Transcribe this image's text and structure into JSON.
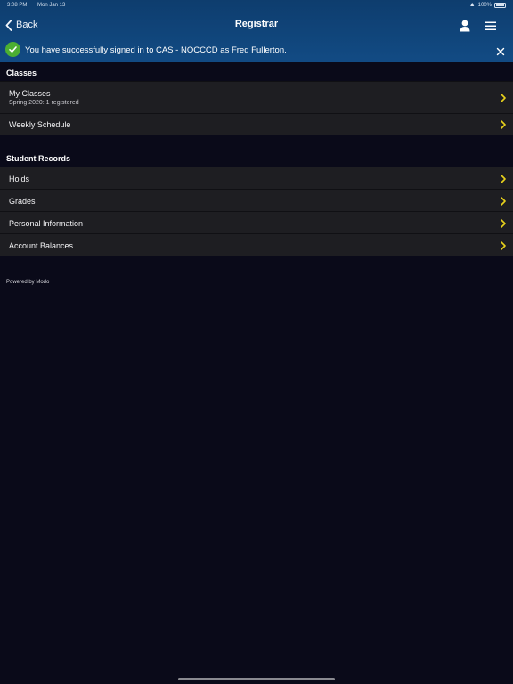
{
  "status_bar": {
    "time": "3:08 PM",
    "date": "Mon Jan 13",
    "battery": "100%"
  },
  "nav": {
    "back_label": "Back",
    "title": "Registrar"
  },
  "banner": {
    "message": "You have successfully signed in to CAS - NOCCCD as Fred Fullerton."
  },
  "sections": [
    {
      "header": "Classes",
      "items": [
        {
          "label": "My Classes",
          "sublabel": "Spring 2020: 1 registered"
        },
        {
          "label": "Weekly Schedule"
        }
      ]
    },
    {
      "header": "Student Records",
      "items": [
        {
          "label": "Holds"
        },
        {
          "label": "Grades"
        },
        {
          "label": "Personal Information"
        },
        {
          "label": "Account Balances"
        }
      ]
    }
  ],
  "footer": {
    "powered_by": "Powered by Modo"
  },
  "colors": {
    "header_gradient_top": "#0e3d6e",
    "header_gradient_bottom": "#124b84",
    "background": "#0a0a19",
    "row_background": "#1e1e22",
    "chevron": "#e8d21c",
    "success": "#4caf32"
  }
}
